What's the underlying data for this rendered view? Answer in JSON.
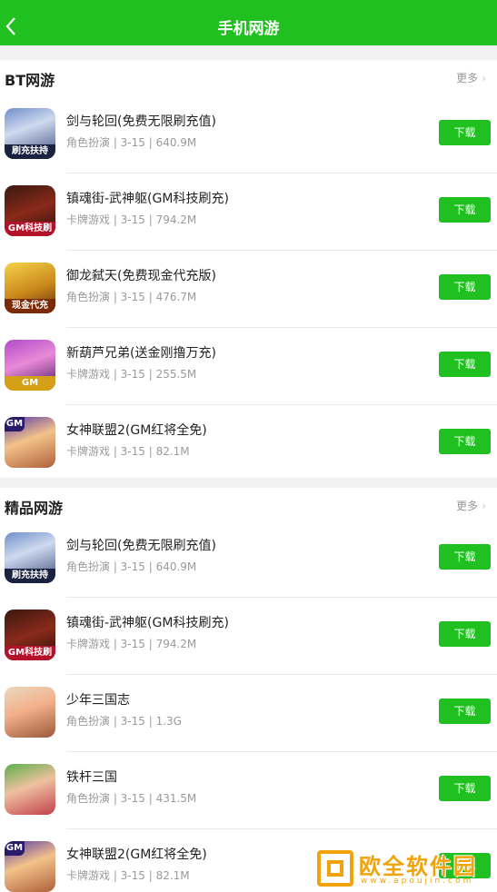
{
  "header": {
    "title": "手机网游"
  },
  "sections": [
    {
      "title": "BT网游",
      "more_label": "更多",
      "games": [
        {
          "name": "剑与轮回(免费无限刷充值)",
          "meta": "角色扮演 | 3-15 | 640.9M",
          "button": "下载"
        },
        {
          "name": "镇魂街-武神躯(GM科技刷充)",
          "meta": "卡牌游戏 | 3-15 | 794.2M",
          "button": "下载"
        },
        {
          "name": "御龙弑天(免费现金代充版)",
          "meta": "角色扮演 | 3-15 | 476.7M",
          "button": "下载"
        },
        {
          "name": "新葫芦兄弟(送金刚撸万充)",
          "meta": "卡牌游戏 | 3-15 | 255.5M",
          "button": "下载"
        },
        {
          "name": "女神联盟2(GM红将全免)",
          "meta": "卡牌游戏 | 3-15 | 82.1M",
          "button": "下载"
        }
      ]
    },
    {
      "title": "精品网游",
      "more_label": "更多",
      "games": [
        {
          "name": "剑与轮回(免费无限刷充值)",
          "meta": "角色扮演 | 3-15 | 640.9M",
          "button": "下载"
        },
        {
          "name": "镇魂街-武神躯(GM科技刷充)",
          "meta": "卡牌游戏 | 3-15 | 794.2M",
          "button": "下载"
        },
        {
          "name": "少年三国志",
          "meta": "角色扮演 | 3-15 | 1.3G",
          "button": "下载"
        },
        {
          "name": "铁杆三国",
          "meta": "角色扮演 | 3-15 | 431.5M",
          "button": "下载"
        },
        {
          "name": "女神联盟2(GM红将全免)",
          "meta": "卡牌游戏 | 3-15 | 82.1M",
          "button": "下载"
        }
      ]
    }
  ],
  "icon_badges": {
    "jianyu": "刷充扶持",
    "zhenhun": "GM科技刷充",
    "yulong": "现金代充",
    "huluxiongdi": "GM",
    "nvshen": "GM"
  },
  "watermark": {
    "text": "欧全软件园",
    "sub": "www.apoujin.com"
  },
  "colors": {
    "brand_green": "#1fc01f",
    "watermark_orange": "#f0a30a"
  }
}
